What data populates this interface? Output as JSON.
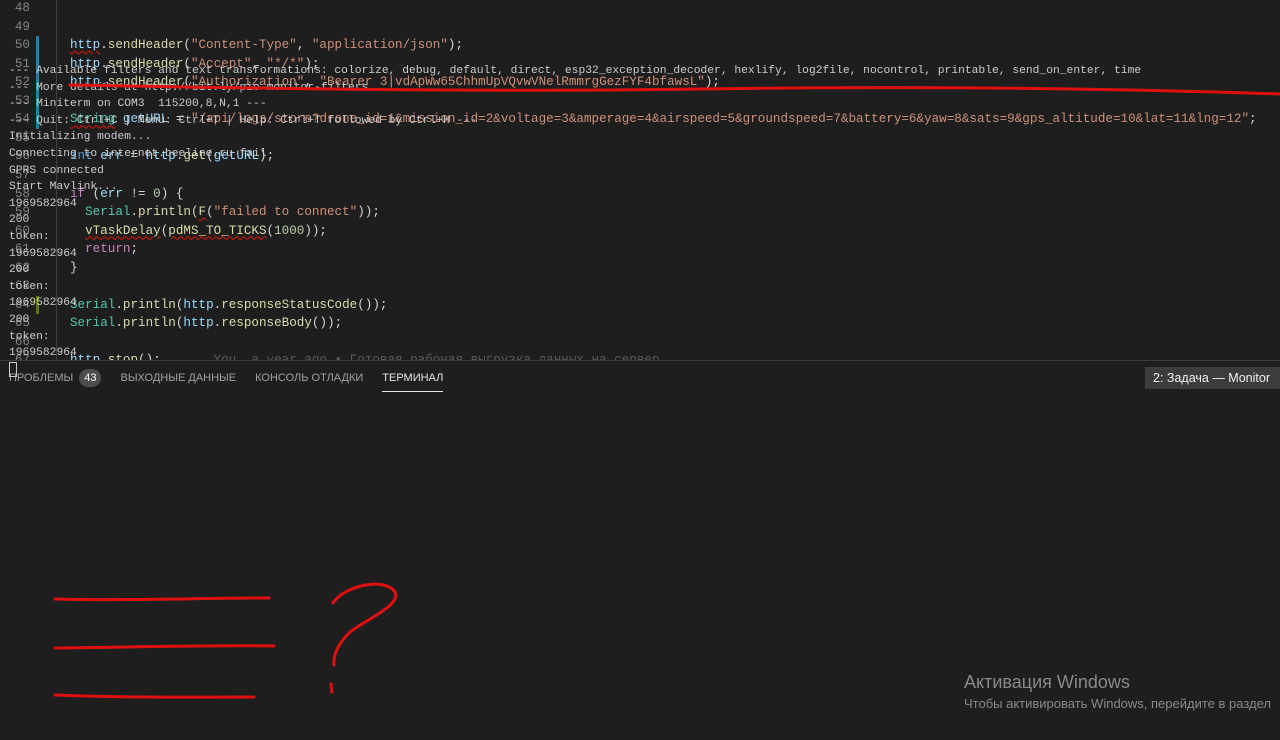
{
  "editor": {
    "lines": [
      {
        "num": "48",
        "tokens": []
      },
      {
        "num": "49",
        "tokens": []
      },
      {
        "num": "50",
        "tokens": [
          [
            "var sq",
            "http"
          ],
          [
            "p",
            "."
          ],
          [
            "fn",
            "sendHeader"
          ],
          [
            "p",
            "("
          ],
          [
            "str",
            "\"Content-Type\""
          ],
          [
            "p",
            ", "
          ],
          [
            "str",
            "\"application/json\""
          ],
          [
            "p",
            ");"
          ]
        ]
      },
      {
        "num": "51",
        "tokens": [
          [
            "var",
            "http"
          ],
          [
            "p",
            "."
          ],
          [
            "fn",
            "sendHeader"
          ],
          [
            "p",
            "("
          ],
          [
            "str",
            "\"Accept\""
          ],
          [
            "p",
            ", "
          ],
          [
            "str",
            "\"*/*\""
          ],
          [
            "p",
            ");"
          ]
        ]
      },
      {
        "num": "52",
        "tokens": [
          [
            "var",
            "http"
          ],
          [
            "p",
            "."
          ],
          [
            "fn",
            "sendHeader"
          ],
          [
            "p",
            "("
          ],
          [
            "str",
            "\"Authorization\""
          ],
          [
            "p",
            ", "
          ],
          [
            "str",
            "\"Bearer 3|vdApWw65ChhmUpVQvwVNelRmmrgGezFYF4bfawsL\""
          ],
          [
            "p",
            ");"
          ]
        ]
      },
      {
        "num": "53",
        "tokens": []
      },
      {
        "num": "54",
        "tokens": [
          [
            "type sq",
            "String"
          ],
          [
            "p",
            " "
          ],
          [
            "var",
            "getURL"
          ],
          [
            "p",
            " = "
          ],
          [
            "str",
            "\"/api/logs/store?drone_id=1&mission_id=2&voltage=3&amperage=4&airspeed=5&groundspeed=7&battery=6&yaw=8&sats=9&gps_altitude=10&lat=11&lng=12\""
          ],
          [
            "p",
            ";"
          ]
        ]
      },
      {
        "num": "55",
        "tokens": []
      },
      {
        "num": "56",
        "tokens": [
          [
            "kw",
            "int"
          ],
          [
            "p",
            " "
          ],
          [
            "var",
            "err"
          ],
          [
            "p",
            " = "
          ],
          [
            "var",
            "http"
          ],
          [
            "p",
            "."
          ],
          [
            "fn",
            "get"
          ],
          [
            "p",
            "("
          ],
          [
            "var",
            "getURL"
          ],
          [
            "p",
            ");"
          ]
        ]
      },
      {
        "num": "57",
        "tokens": []
      },
      {
        "num": "58",
        "tokens": [
          [
            "ctl",
            "if"
          ],
          [
            "p",
            " ("
          ],
          [
            "var",
            "err"
          ],
          [
            "p",
            " != "
          ],
          [
            "num",
            "0"
          ],
          [
            "p",
            ") {"
          ]
        ]
      },
      {
        "num": "59",
        "tokens": [
          [
            "p",
            "  "
          ],
          [
            "type",
            "Serial"
          ],
          [
            "p",
            "."
          ],
          [
            "fn",
            "println"
          ],
          [
            "p",
            "("
          ],
          [
            "fn sq",
            "F"
          ],
          [
            "p",
            "("
          ],
          [
            "str",
            "\"failed to connect\""
          ],
          [
            "p",
            "));"
          ]
        ]
      },
      {
        "num": "60",
        "tokens": [
          [
            "p",
            "  "
          ],
          [
            "fn sq",
            "vTaskDelay"
          ],
          [
            "p",
            "("
          ],
          [
            "fn sq",
            "pdMS_TO_TICKS"
          ],
          [
            "p",
            "("
          ],
          [
            "num",
            "1000"
          ],
          [
            "p",
            "));"
          ]
        ]
      },
      {
        "num": "61",
        "tokens": [
          [
            "p",
            "  "
          ],
          [
            "ctl",
            "return"
          ],
          [
            "p",
            ";"
          ]
        ]
      },
      {
        "num": "62",
        "tokens": [
          [
            "p",
            "}"
          ]
        ]
      },
      {
        "num": "63",
        "tokens": []
      },
      {
        "num": "64",
        "tokens": [
          [
            "type",
            "Serial"
          ],
          [
            "p",
            "."
          ],
          [
            "fn",
            "println"
          ],
          [
            "p",
            "("
          ],
          [
            "var",
            "http"
          ],
          [
            "p",
            "."
          ],
          [
            "fn",
            "responseStatusCode"
          ],
          [
            "p",
            "());"
          ]
        ]
      },
      {
        "num": "65",
        "tokens": [
          [
            "type",
            "Serial"
          ],
          [
            "p",
            "."
          ],
          [
            "fn",
            "println"
          ],
          [
            "p",
            "("
          ],
          [
            "var",
            "http"
          ],
          [
            "p",
            "."
          ],
          [
            "fn",
            "responseBody"
          ],
          [
            "p",
            "());"
          ]
        ]
      },
      {
        "num": "66",
        "tokens": []
      },
      {
        "num": "67",
        "tokens": [
          [
            "var",
            "http"
          ],
          [
            "p",
            "."
          ],
          [
            "fn",
            "stop"
          ],
          [
            "p",
            "();"
          ],
          [
            "blame",
            "       You, a year ago • Готовая рабочая выгрузка данных на сервер"
          ]
        ]
      }
    ]
  },
  "panel": {
    "tabs": [
      {
        "label": "ПРОБЛЕМЫ",
        "badge": "43"
      },
      {
        "label": "ВЫХОДНЫЕ ДАННЫЕ"
      },
      {
        "label": "КОНСОЛЬ ОТЛАДКИ"
      },
      {
        "label": "ТЕРМИНАЛ",
        "active": true
      }
    ],
    "terminal_selector": "2: Задача — Monitor"
  },
  "terminal": {
    "lines": [
      "--- Available filters and text transformations: colorize, debug, default, direct, esp32_exception_decoder, hexlify, log2file, nocontrol, printable, send_on_enter, time",
      "--- More details at http://bit.ly/pio-monitor-filters",
      "--- Miniterm on COM3  115200,8,N,1 ---",
      "--- Quit: Ctrl+C | Menu: Ctrl+T | Help: Ctrl+T followed by Ctrl+H ---",
      "Initializing modem...",
      "Connecting to internet.beeline.ru fail",
      "GPRS connected",
      "Start Mavlink...",
      "1969582964",
      "200",
      "token:",
      "1969582964",
      "200",
      "token:",
      "1969582964",
      "200",
      "token:",
      "1969582964"
    ]
  },
  "watermark": {
    "title": "Активация Windows",
    "subtitle": "Чтобы активировать Windows, перейдите в раздел"
  },
  "colors": {
    "ink": "#e01010",
    "background": "#1e1e1e",
    "git_modified": "#1b81a8",
    "git_added": "#587c0c"
  }
}
